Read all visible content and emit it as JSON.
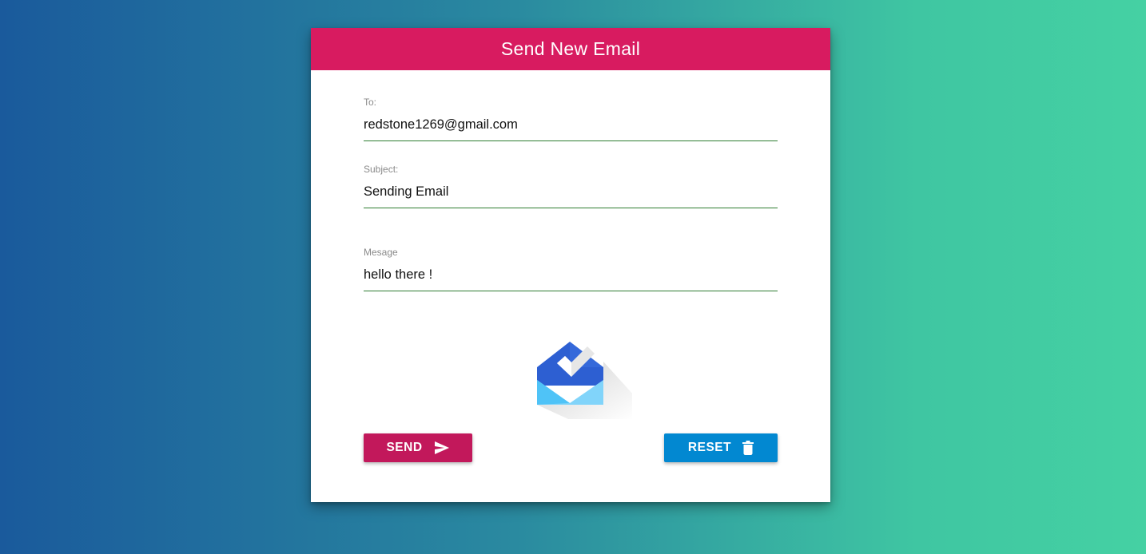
{
  "header": {
    "title": "Send New Email"
  },
  "form": {
    "to": {
      "label": "To:",
      "value": "redstone1269@gmail.com"
    },
    "subject": {
      "label": "Subject:",
      "value": "Sending Email"
    },
    "message": {
      "label": "Mesage",
      "value": "hello there !"
    }
  },
  "logo": {
    "icon": "inbox-envelope-check-icon"
  },
  "buttons": {
    "send_label": "SEND",
    "send_icon": "send-icon",
    "reset_label": "RESET",
    "reset_icon": "trash-icon"
  },
  "colors": {
    "header": "#d81b60",
    "send_button": "#c2185b",
    "reset_button": "#0288d1",
    "underline": "#2e7d32"
  }
}
